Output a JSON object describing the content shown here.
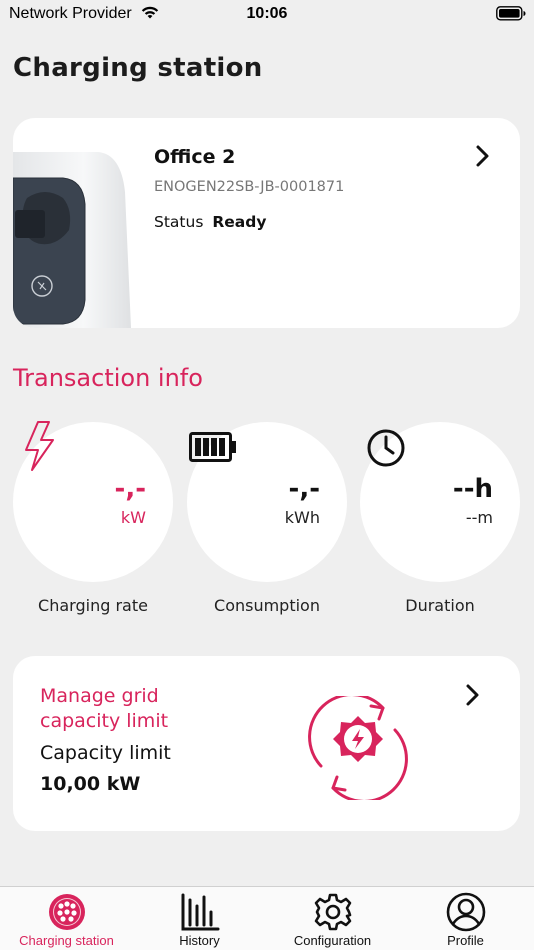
{
  "status_bar": {
    "provider": "Network Provider",
    "time": "10:06"
  },
  "page": {
    "title": "Charging station"
  },
  "station": {
    "name": "Office 2",
    "serial": "ENOGEN22SB-JB-0001871",
    "status_label": "Status",
    "status_value": "Ready"
  },
  "transaction": {
    "title": "Transaction info",
    "items": [
      {
        "value": "-,-",
        "unit": "kW",
        "label": "Charging rate",
        "icon": "lightning-icon"
      },
      {
        "value": "-,-",
        "unit": "kWh",
        "label": "Consumption",
        "icon": "battery-icon"
      },
      {
        "value": "--h",
        "unit": "--m",
        "label": "Duration",
        "icon": "clock-icon"
      }
    ]
  },
  "grid": {
    "title": "Manage grid capacity limit",
    "capacity_label": "Capacity limit",
    "capacity_value": "10,00 kW",
    "icon": "grid-capacity-icon"
  },
  "tabs": [
    {
      "label": "Charging station",
      "icon": "charging-plug-icon",
      "active": true
    },
    {
      "label": "History",
      "icon": "bar-chart-icon",
      "active": false
    },
    {
      "label": "Configuration",
      "icon": "gear-icon",
      "active": false
    },
    {
      "label": "Profile",
      "icon": "user-icon",
      "active": false
    }
  ],
  "colors": {
    "accent": "#d8245c",
    "background": "#efefef",
    "card": "#ffffff"
  }
}
